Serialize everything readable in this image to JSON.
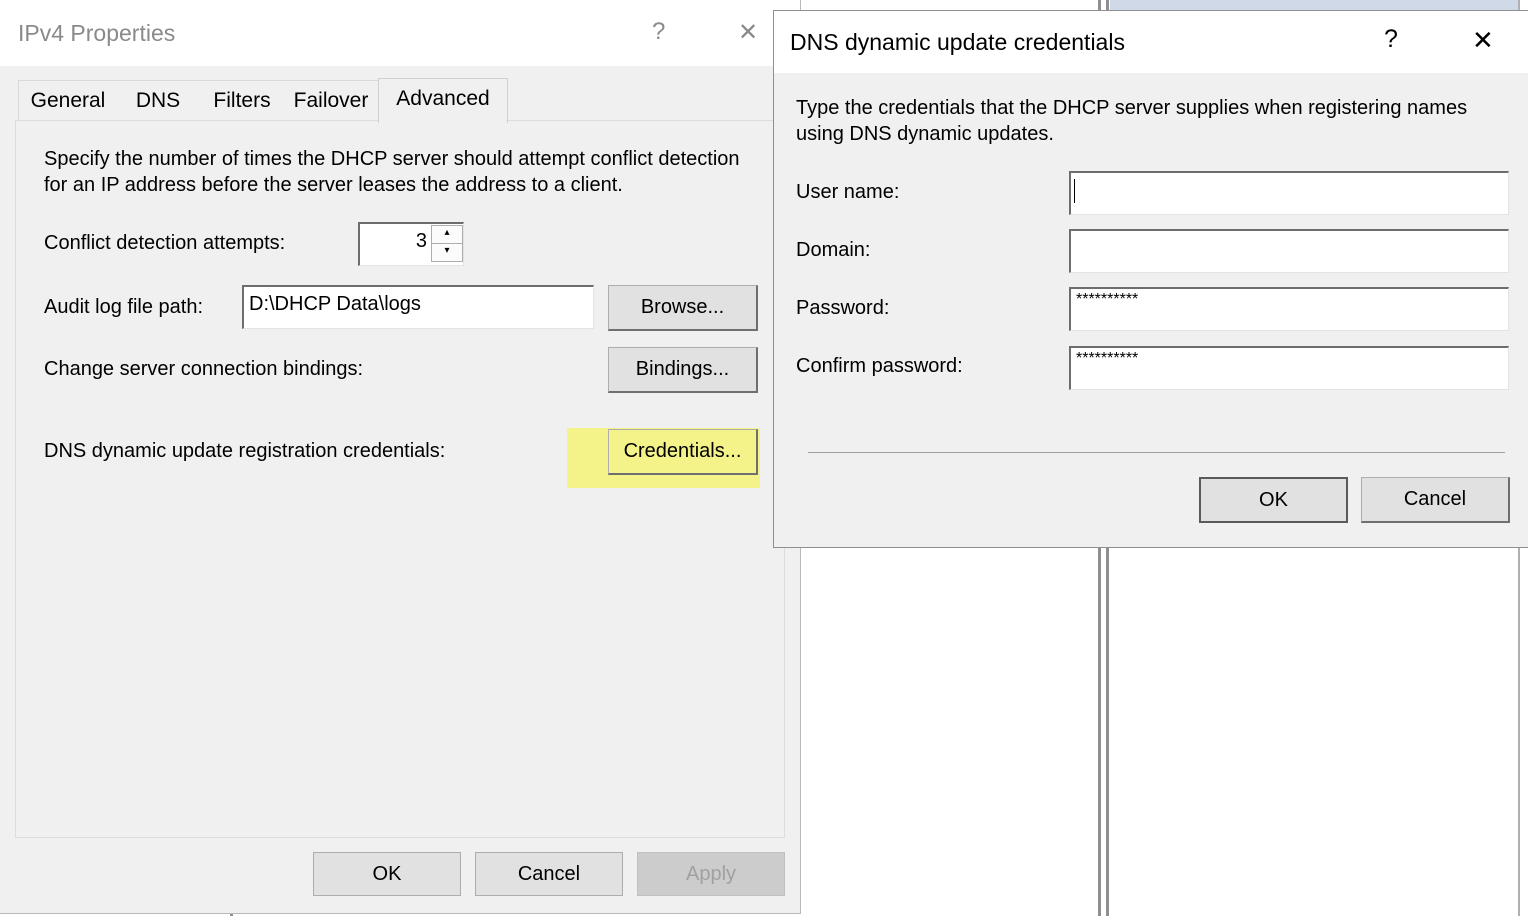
{
  "ipv4_dialog": {
    "title": "IPv4 Properties",
    "help_icon": "?",
    "close_icon": "✕",
    "tabs": [
      {
        "label": "General"
      },
      {
        "label": "DNS"
      },
      {
        "label": "Filters"
      },
      {
        "label": "Failover"
      },
      {
        "label": "Advanced"
      }
    ],
    "active_tab": "Advanced",
    "description": "Specify the number of times the DHCP server should attempt conflict detection for an IP address before the server leases the address to a client.",
    "conflict_label": "Conflict detection attempts:",
    "conflict_value": "3",
    "audit_label": "Audit log file path:",
    "audit_value": "D:\\DHCP Data\\logs",
    "browse_button": "Browse...",
    "bindings_label": "Change server connection bindings:",
    "bindings_button": "Bindings...",
    "credentials_label": "DNS dynamic update registration credentials:",
    "credentials_button": "Credentials...",
    "ok_button": "OK",
    "cancel_button": "Cancel",
    "apply_button": "Apply"
  },
  "dns_dialog": {
    "title": "DNS dynamic update credentials",
    "help_icon": "?",
    "close_icon": "✕",
    "description": "Type the credentials that the DHCP server supplies when registering names using DNS dynamic updates.",
    "username_label": "User name:",
    "username_value": "",
    "domain_label": "Domain:",
    "domain_value": "",
    "password_label": "Password:",
    "password_value": "**********",
    "confirm_label": "Confirm password:",
    "confirm_value": "**********",
    "ok_button": "OK",
    "cancel_button": "Cancel"
  },
  "colors": {
    "highlight": "#f3f38a",
    "dialog_bg": "#f0f0f0",
    "button_bg": "#e1e1e1"
  }
}
